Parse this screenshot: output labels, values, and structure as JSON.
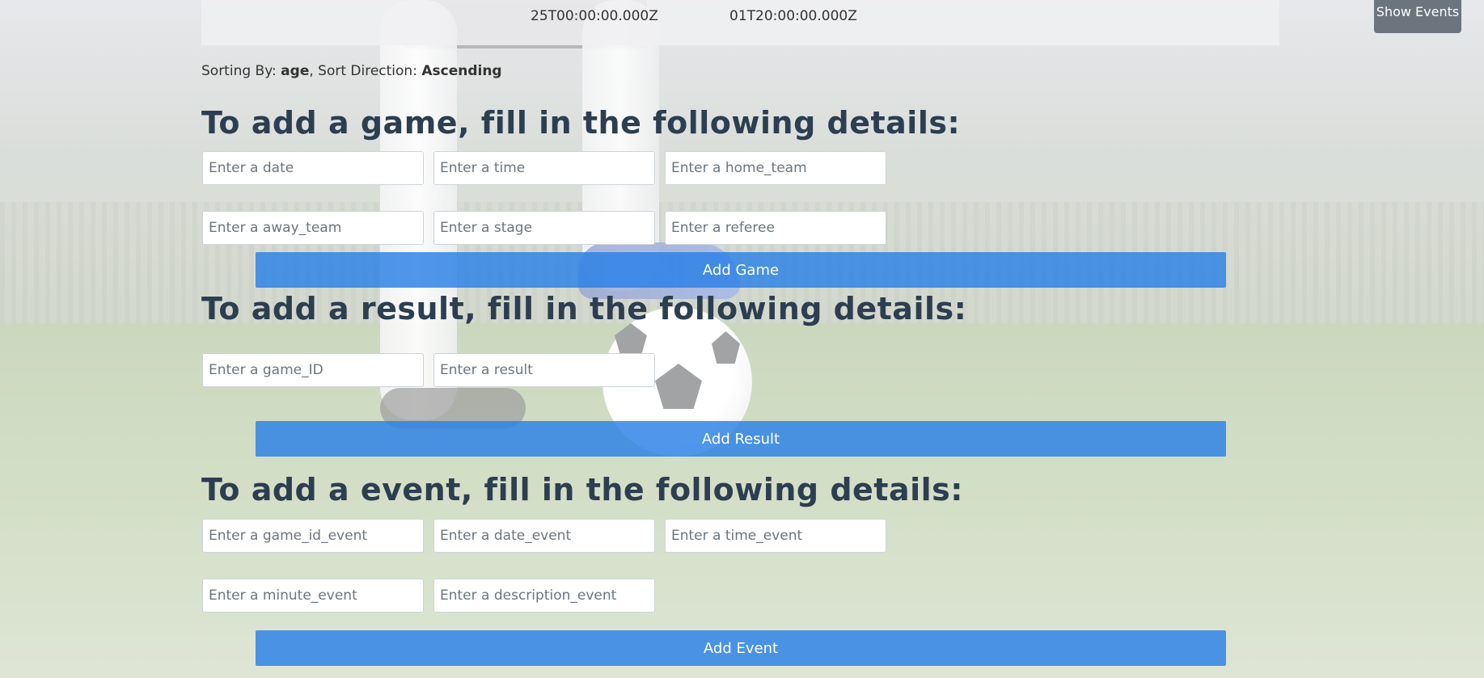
{
  "top_row": {
    "date_cell": "25T00:00:00.000Z",
    "date_cell_2": "01T20:00:00.000Z",
    "show_events_label": "Show Events"
  },
  "sorting": {
    "prefix": "Sorting By: ",
    "field": "age",
    "middle": ", Sort Direction: ",
    "direction": "Ascending"
  },
  "game_form": {
    "heading": "To add a game, fill in the following details:",
    "placeholders": {
      "date": "Enter a date",
      "time": "Enter a time",
      "home_team": "Enter a home_team",
      "away_team": "Enter a away_team",
      "stage": "Enter a stage",
      "referee": "Enter a referee"
    },
    "button": "Add Game"
  },
  "result_form": {
    "heading": "To add a result, fill in the following details:",
    "placeholders": {
      "game_id": "Enter a game_ID",
      "result": "Enter a result"
    },
    "button": "Add Result"
  },
  "event_form": {
    "heading": "To add a event, fill in the following details:",
    "placeholders": {
      "game_id_event": "Enter a game_id_event",
      "date_event": "Enter a date_event",
      "time_event": "Enter a time_event",
      "minute_event": "Enter a minute_event",
      "description_event": "Enter a description_event"
    },
    "button": "Add Event"
  },
  "colors": {
    "heading": "#2c3e50",
    "primary_button": "#2980e6",
    "secondary_button": "#6c757d"
  }
}
